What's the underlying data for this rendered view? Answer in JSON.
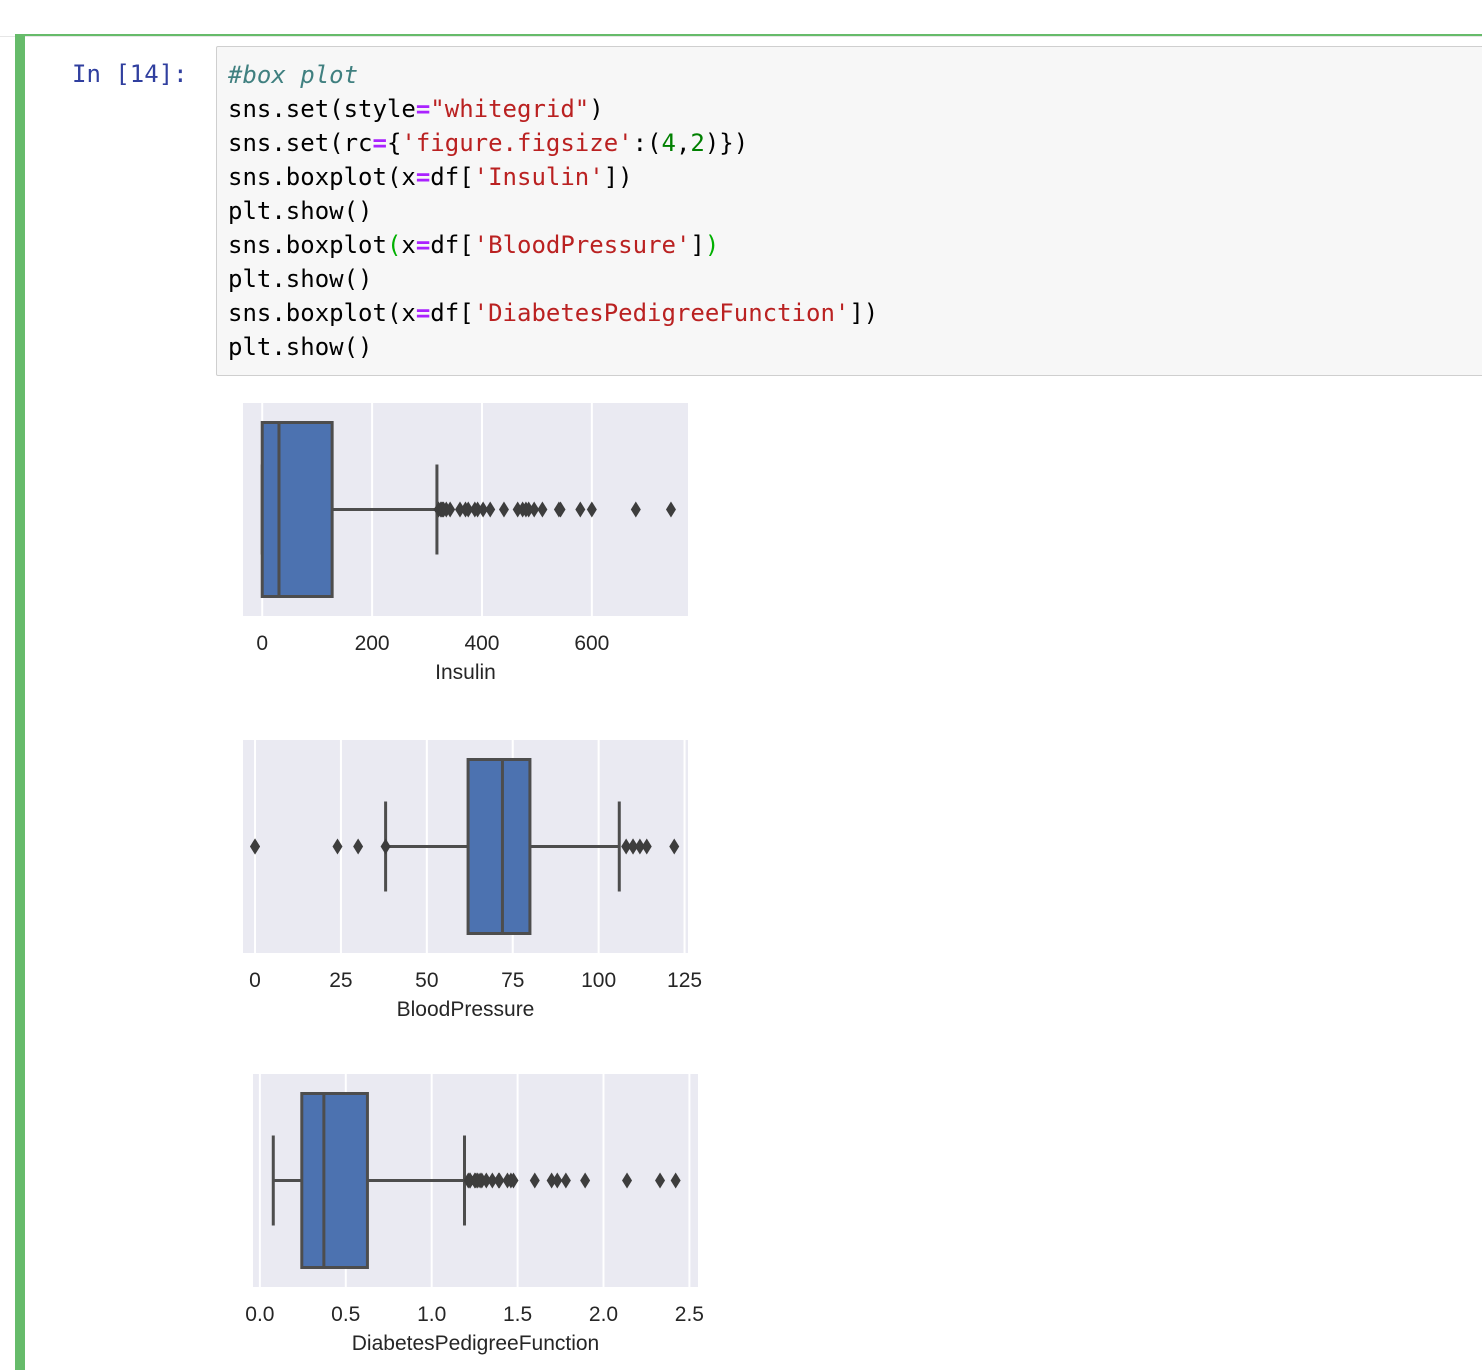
{
  "notebook": {
    "prompt": "In [14]:",
    "code": [
      [
        {
          "t": "#box plot",
          "c": "comment"
        }
      ],
      [
        {
          "t": "sns.set(style"
        },
        {
          "t": "=",
          "c": "op"
        },
        {
          "t": "\"whitegrid\"",
          "c": "str"
        },
        {
          "t": ")"
        }
      ],
      [
        {
          "t": "sns.set(rc"
        },
        {
          "t": "=",
          "c": "op"
        },
        {
          "t": "{"
        },
        {
          "t": "'figure.figsize'",
          "c": "str"
        },
        {
          "t": ":("
        },
        {
          "t": "4",
          "c": "num"
        },
        {
          "t": ","
        },
        {
          "t": "2",
          "c": "num"
        },
        {
          "t": ")})"
        }
      ],
      [
        {
          "t": "sns.boxplot(x"
        },
        {
          "t": "=",
          "c": "op"
        },
        {
          "t": "df["
        },
        {
          "t": "'Insulin'",
          "c": "str"
        },
        {
          "t": "])"
        }
      ],
      [
        {
          "t": "plt.show()"
        }
      ],
      [
        {
          "t": "sns.boxplot"
        },
        {
          "t": "(",
          "c": "match"
        },
        {
          "t": "x"
        },
        {
          "t": "=",
          "c": "op"
        },
        {
          "t": "df["
        },
        {
          "t": "'BloodPressure'",
          "c": "str"
        },
        {
          "t": "]"
        },
        {
          "t": ")",
          "c": "match"
        }
      ],
      [
        {
          "t": "plt.show()"
        }
      ],
      [
        {
          "t": "sns.boxplot(x"
        },
        {
          "t": "=",
          "c": "op"
        },
        {
          "t": "df["
        },
        {
          "t": "'DiabetesPedigreeFunction'",
          "c": "str"
        },
        {
          "t": "])"
        }
      ],
      [
        {
          "t": "plt.show()"
        }
      ]
    ]
  },
  "chart_data": [
    {
      "type": "box",
      "xlabel": "Insulin",
      "xlim": [
        -35,
        775
      ],
      "xticks": [
        0,
        200,
        400,
        600
      ],
      "xtick_labels": [
        "0",
        "200",
        "400",
        "600"
      ],
      "q1": 0,
      "median": 30.5,
      "q3": 127.25,
      "whisker_low": 0,
      "whisker_high": 318,
      "outliers": [
        321,
        325,
        326,
        328,
        330,
        335,
        342,
        360,
        370,
        375,
        387,
        392,
        402,
        415,
        440,
        465,
        474,
        480,
        485,
        495,
        510,
        540,
        543,
        579,
        600,
        680,
        744
      ],
      "box_color": "#4c72b0",
      "background": "#eaeaf2",
      "grid": true
    },
    {
      "type": "box",
      "xlabel": "BloodPressure",
      "xlim": [
        -3.5,
        126
      ],
      "xticks": [
        0,
        25,
        50,
        75,
        100,
        125
      ],
      "xtick_labels": [
        "0",
        "25",
        "50",
        "75",
        "100",
        "125"
      ],
      "q1": 62,
      "median": 72,
      "q3": 80,
      "whisker_low": 38,
      "whisker_high": 106,
      "outliers": [
        0,
        0,
        24,
        30,
        38,
        108,
        110,
        110,
        112,
        114,
        122
      ],
      "box_color": "#4c72b0",
      "background": "#eaeaf2",
      "grid": true
    },
    {
      "type": "box",
      "xlabel": "DiabetesPedigreeFunction",
      "xlim": [
        -0.04,
        2.55
      ],
      "xticks": [
        0.0,
        0.5,
        1.0,
        1.5,
        2.0,
        2.5
      ],
      "xtick_labels": [
        "0.0",
        "0.5",
        "1.0",
        "1.5",
        "2.0",
        "2.5"
      ],
      "q1": 0.244,
      "median": 0.3725,
      "q3": 0.626,
      "whisker_low": 0.078,
      "whisker_high": 1.191,
      "outliers": [
        1.213,
        1.222,
        1.224,
        1.251,
        1.258,
        1.268,
        1.282,
        1.292,
        1.318,
        1.353,
        1.39,
        1.394,
        1.441,
        1.461,
        1.476,
        1.6,
        1.698,
        1.731,
        1.781,
        1.893,
        2.137,
        2.329,
        2.42
      ],
      "box_color": "#4c72b0",
      "background": "#eaeaf2",
      "grid": true
    }
  ]
}
